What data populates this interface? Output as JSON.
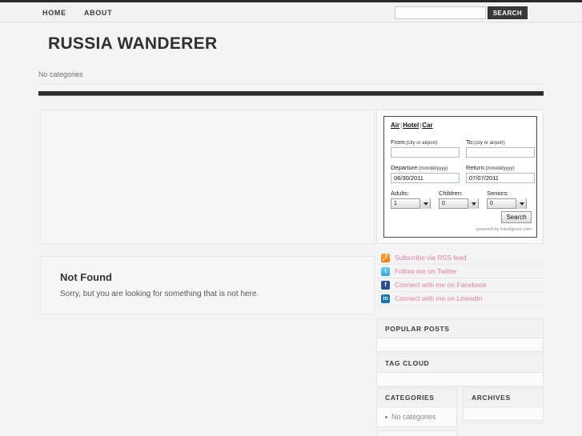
{
  "header": {
    "nav": [
      {
        "label": "HOME",
        "name": "nav-home"
      },
      {
        "label": "ABOUT",
        "name": "nav-about"
      }
    ],
    "search": {
      "value": "",
      "placeholder": "",
      "button_label": "SEARCH"
    }
  },
  "site": {
    "title": "RUSSIA WANDERER",
    "categories_strip": "No categories"
  },
  "main": {
    "not_found": {
      "title": "Not Found",
      "body": "Sorry, but you are looking for something that is not here."
    }
  },
  "travel_widget": {
    "tabs": [
      {
        "label": "Air"
      },
      {
        "label": "Hotel"
      },
      {
        "label": "Car"
      }
    ],
    "separator": "|",
    "from_label": "From:",
    "from_hint": "(city or airport)",
    "from_value": "",
    "to_label": "To:",
    "to_hint": "(city or airport)",
    "to_value": "",
    "departure_label": "Departure:",
    "departure_hint": "(mm/dd/yyyy)",
    "departure_value": "06/30/2011",
    "return_label": "Return:",
    "return_hint": "(mm/dd/yyyy)",
    "return_value": "07/07/2011",
    "adults_label": "Adults:",
    "adults_value": "1",
    "children_label": "Children:",
    "children_value": "0",
    "seniors_label": "Seniors:",
    "seniors_value": "0",
    "search_button": "Search",
    "credit": "powered by travelgrove.com"
  },
  "social": {
    "links": [
      {
        "icon": "rss-icon",
        "label": "Subscribe via RSS feed",
        "color": "#ef7c12"
      },
      {
        "icon": "twitter-icon",
        "label": "Follow me on Twitter",
        "color": "#33a8dd"
      },
      {
        "icon": "facebook-icon",
        "label": "Connect with me on Facebook",
        "color": "#2c4d8e"
      },
      {
        "icon": "linkedin-icon",
        "label": "Connect with me on LinkedIn",
        "color": "#1178b3"
      }
    ],
    "icon_glyphs": {
      "twitter": "t",
      "facebook": "f",
      "linkedin": "in"
    },
    "text_color": "#e87ba6"
  },
  "widgets": {
    "popular_posts": {
      "title": "POPULAR POSTS",
      "items": []
    },
    "tag_cloud": {
      "title": "TAG CLOUD",
      "items": []
    },
    "categories": {
      "title": "CATEGORIES",
      "items": [
        "No categories"
      ]
    },
    "archives": {
      "title": "ARCHIVES",
      "items": []
    }
  },
  "colors": {
    "page_bg": "#f4f4f4",
    "dark_rule": "#2b2b2b",
    "nav_text": "#3a3a3a",
    "link_pink": "#e87ba6"
  }
}
